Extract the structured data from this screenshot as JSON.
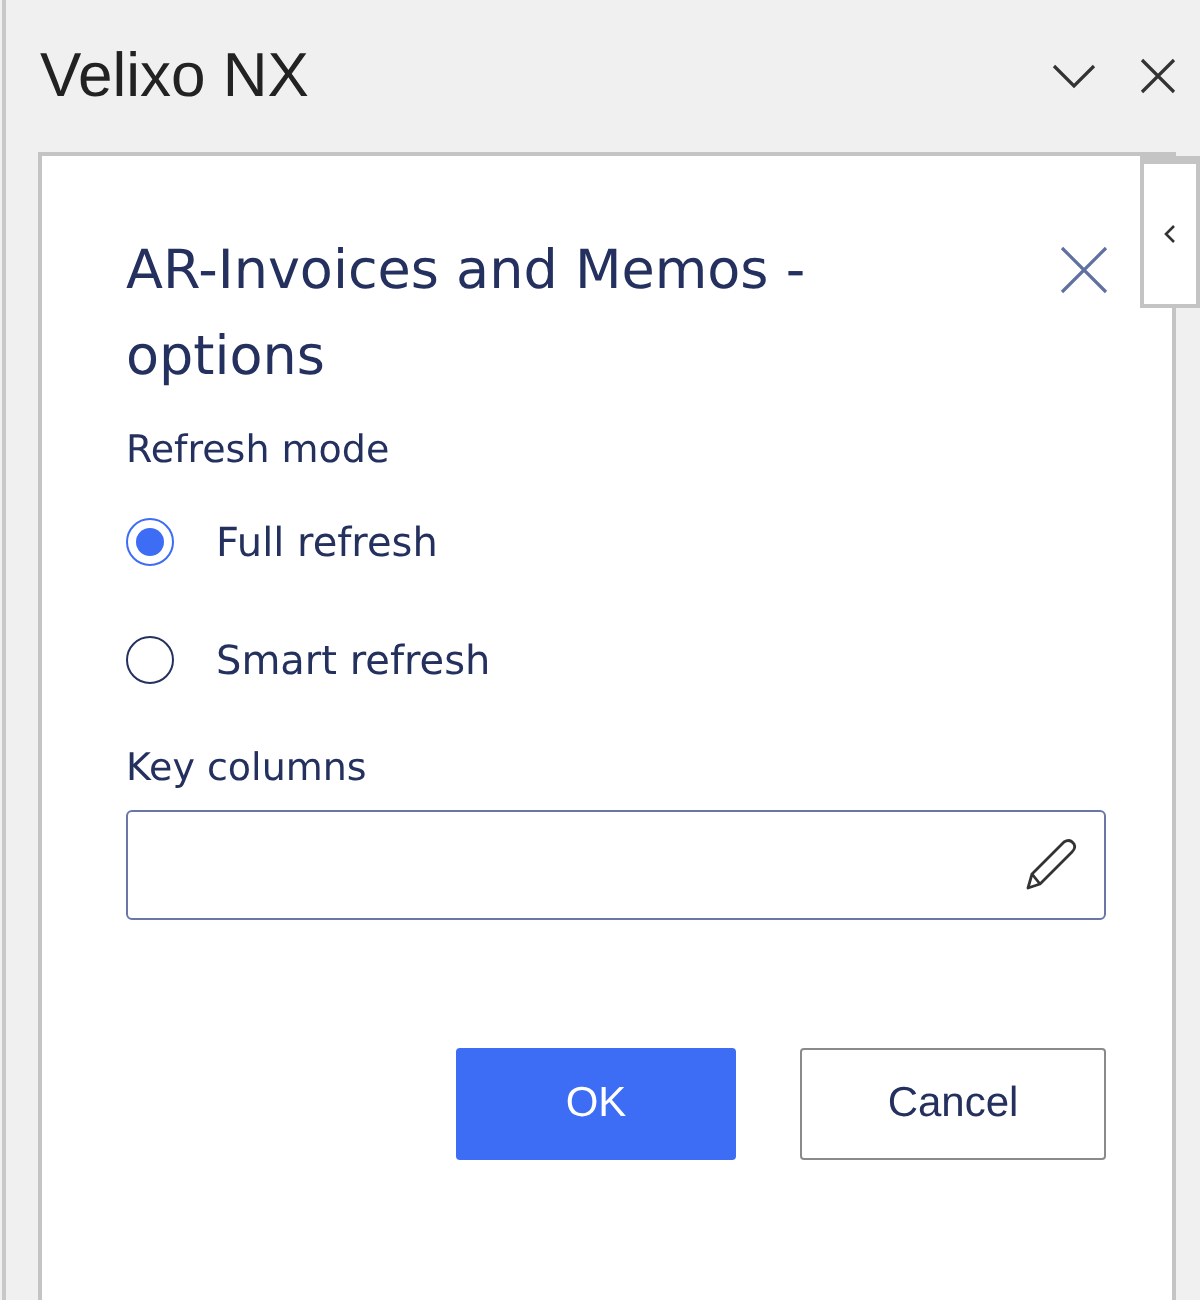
{
  "pane": {
    "title": "Velixo NX"
  },
  "dialog": {
    "title": "AR-Invoices and Memos - options",
    "refresh_mode": {
      "label": "Refresh mode",
      "options": [
        {
          "label": "Full refresh",
          "selected": true
        },
        {
          "label": "Smart refresh",
          "selected": false
        }
      ]
    },
    "key_columns": {
      "label": "Key columns"
    },
    "buttons": [
      {
        "label": "OK",
        "kind": "primary"
      },
      {
        "label": "Cancel",
        "kind": "secondary"
      }
    ]
  }
}
